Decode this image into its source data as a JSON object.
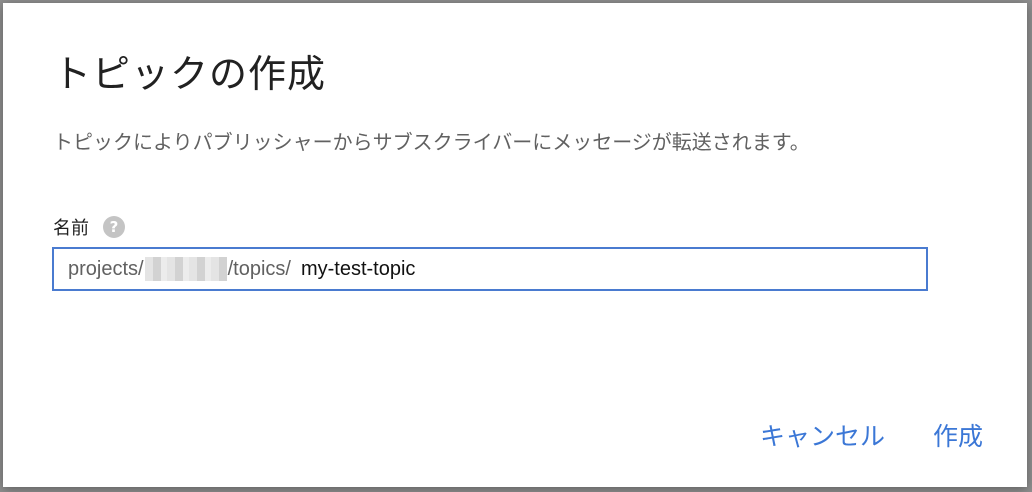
{
  "dialog": {
    "title": "トピックの作成",
    "description": "トピックによりパブリッシャーからサブスクライバーにメッセージが転送されます。",
    "field": {
      "label": "名前",
      "help_icon": "question-circle-icon",
      "prefix_start": "projects/",
      "prefix_end": "/topics/",
      "value": "my-test-topic"
    },
    "actions": {
      "cancel_label": "キャンセル",
      "create_label": "作成"
    },
    "colors": {
      "accent": "#3b77d6",
      "input_border": "#4a7bd0"
    }
  }
}
